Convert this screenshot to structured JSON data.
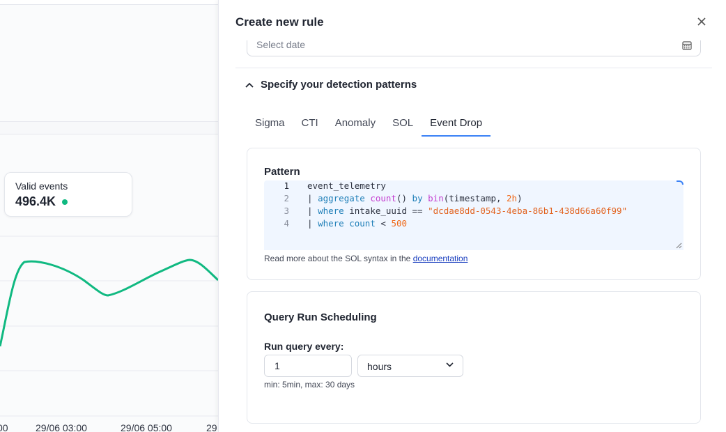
{
  "background": {
    "tooltip": {
      "label": "Valid events",
      "value": "496.4K",
      "dot_color": "#10b981"
    },
    "x_ticks": [
      "00",
      "29/06 03:00",
      "29/06 05:00",
      "29"
    ]
  },
  "drawer": {
    "title": "Create new rule",
    "date_placeholder": "Select date",
    "section_title": "Specify your detection patterns",
    "tabs": [
      {
        "label": "Sigma",
        "active": false
      },
      {
        "label": "CTI",
        "active": false
      },
      {
        "label": "Anomaly",
        "active": false
      },
      {
        "label": "SOL",
        "active": false
      },
      {
        "label": "Event Drop",
        "active": true
      }
    ],
    "pattern": {
      "title": "Pattern",
      "lines": [
        {
          "n": "1",
          "text": "event_telemetry"
        },
        {
          "n": "2",
          "text": "| aggregate count() by bin(timestamp, 2h)"
        },
        {
          "n": "3",
          "text": "| where intake_uuid == \"dcdae8dd-0543-4eba-86b1-438d66a60f99\""
        },
        {
          "n": "4",
          "text": "| where count < 500"
        }
      ],
      "help_prefix": "Read more about the SOL syntax in the ",
      "help_link": "documentation"
    },
    "scheduling": {
      "title": "Query Run Scheduling",
      "run_label": "Run query every:",
      "interval_value": "1",
      "unit": "hours",
      "hint": "min: 5min, max: 30 days"
    }
  }
}
